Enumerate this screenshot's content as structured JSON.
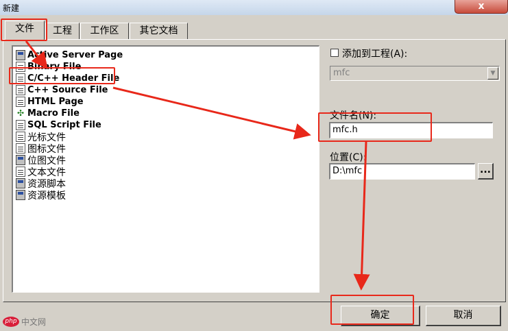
{
  "window": {
    "title": "新建",
    "close_glyph": "x"
  },
  "tabs": [
    {
      "label": "文件",
      "active": true
    },
    {
      "label": "工程",
      "active": false
    },
    {
      "label": "工作区",
      "active": false
    },
    {
      "label": "其它文档",
      "active": false
    }
  ],
  "file_types": [
    {
      "label": "Active Server Page",
      "icon": "asp-page-icon"
    },
    {
      "label": "Binary File",
      "icon": "binary-file-icon"
    },
    {
      "label": "C/C++ Header File",
      "icon": "header-file-icon",
      "selected": true
    },
    {
      "label": "C++ Source File",
      "icon": "source-file-icon"
    },
    {
      "label": "HTML Page",
      "icon": "html-page-icon"
    },
    {
      "label": "Macro File",
      "icon": "macro-file-icon"
    },
    {
      "label": "SQL Script File",
      "icon": "sql-script-icon"
    },
    {
      "label": "光标文件",
      "icon": "cursor-file-icon"
    },
    {
      "label": "图标文件",
      "icon": "icon-file-icon"
    },
    {
      "label": "位图文件",
      "icon": "bitmap-file-icon"
    },
    {
      "label": "文本文件",
      "icon": "text-file-icon"
    },
    {
      "label": "资源脚本",
      "icon": "resource-script-icon"
    },
    {
      "label": "资源模板",
      "icon": "resource-template-icon"
    }
  ],
  "add_to_project": {
    "label": "添加到工程(A):",
    "checked": false
  },
  "project_combo": {
    "value": "mfc"
  },
  "filename": {
    "label": "文件名(N):",
    "value": "mfc.h"
  },
  "location": {
    "label": "位置(C):",
    "value": "D:\\mfc",
    "browse_label": "..."
  },
  "buttons": {
    "ok": "确定",
    "cancel": "取消"
  },
  "watermark": {
    "logo": "php",
    "text": "中文网"
  },
  "colors": {
    "annotation_red": "#e8281a",
    "dialog_bg": "#d4d0c8"
  }
}
